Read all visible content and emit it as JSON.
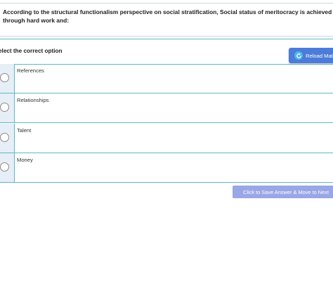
{
  "question": {
    "text": "According to the structural functionalism perspective on social stratification, Social status of meritocracy is achieved through hard work and:"
  },
  "select_label": "elect the correct option",
  "reload_button": {
    "label": "Reload Math",
    "icon": "refresh-icon"
  },
  "options": [
    {
      "label": "References"
    },
    {
      "label": "Relationships"
    },
    {
      "label": "Talent"
    },
    {
      "label": "Money"
    }
  ],
  "save_button": {
    "label": "Click to Save Answer & Move to Next"
  },
  "colors": {
    "accent_line": "#5fb6c7",
    "reload_bg": "#4c7bd9",
    "save_bg": "#9aa7e6"
  }
}
